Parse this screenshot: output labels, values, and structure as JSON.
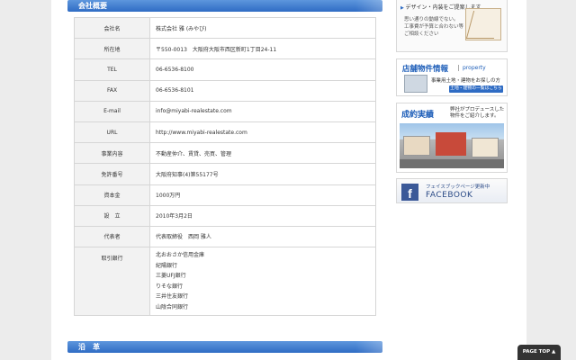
{
  "section1": {
    "title": "会社概要"
  },
  "company": [
    {
      "label": "会社名",
      "value": "株式会社 雅 (みやび)"
    },
    {
      "label": "所在地",
      "value": "〒550-0013　大阪府大阪市西区新町1丁目24-11"
    },
    {
      "label": "TEL",
      "value": "06-6536-8100"
    },
    {
      "label": "FAX",
      "value": "06-6536-8101"
    },
    {
      "label": "E-mail",
      "value": "info@miyabi-realestate.com"
    },
    {
      "label": "URL",
      "value": "http://www.miyabi-realestate.com"
    },
    {
      "label": "事業内容",
      "value": "不動産仲介、賃貸、売買、管理"
    },
    {
      "label": "免許番号",
      "value": "大阪府知事(4)第55177号"
    },
    {
      "label": "資本金",
      "value": "1000万円"
    },
    {
      "label": "設　立",
      "value": "2010年3月2日"
    },
    {
      "label": "代表者",
      "value": "代表取締役　西岡 雅人"
    }
  ],
  "banks": {
    "label": "取引銀行",
    "items": [
      "北おおさか信用金庫",
      "紀陽銀行",
      "三菱UFJ銀行",
      "りそな銀行",
      "三井住友銀行",
      "山陰合同銀行"
    ]
  },
  "section2": {
    "title": "沿　革"
  },
  "sidebar": {
    "top_card": {
      "tag": "デザイン・内装をご提案します",
      "line1": "思い通りの動線でない。",
      "line2": "工事費が予算と合わない等",
      "line3": "ご相談ください"
    },
    "store": {
      "title": "店舗物件情報",
      "subtitle": "property",
      "desc": "事業用土地・建物をお探しの方",
      "link": "土地・建物の一覧はこちら"
    },
    "results": {
      "title": "成約実績",
      "desc1": "弊社がプロデュースした",
      "desc2": "物件をご紹介します。"
    },
    "facebook": {
      "line1": "フェイスブックページ更新中",
      "line2": "FACEBOOK",
      "logo": "f"
    }
  },
  "pagetop": {
    "label": "PAGE TOP ▲"
  },
  "colors": {
    "accent": "#2f6cc4",
    "facebook": "#3b5998"
  }
}
